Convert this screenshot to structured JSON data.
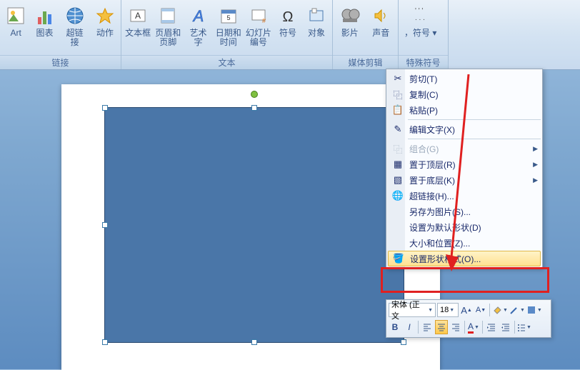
{
  "ribbon": {
    "groups": [
      {
        "label": "链接",
        "buttons": [
          {
            "name": "clipart-button",
            "label": "Art",
            "icon": "clipart"
          },
          {
            "name": "chart-button",
            "label": "图表",
            "icon": "chart"
          },
          {
            "name": "hyperlink-button",
            "label": "超链接",
            "icon": "globe"
          },
          {
            "name": "action-button",
            "label": "动作",
            "icon": "star"
          }
        ]
      },
      {
        "label": "文本",
        "buttons": [
          {
            "name": "textbox-button",
            "label": "文本框",
            "icon": "textbox"
          },
          {
            "name": "headerfooter-button",
            "label": "页眉和\n页脚",
            "icon": "headerfooter"
          },
          {
            "name": "wordart-button",
            "label": "艺术字",
            "icon": "wordart"
          },
          {
            "name": "datetime-button",
            "label": "日期和\n时间",
            "icon": "datetime"
          },
          {
            "name": "slidenumber-button",
            "label": "幻灯片\n编号",
            "icon": "slidenum"
          },
          {
            "name": "symbol-button",
            "label": "符号",
            "icon": "symbol"
          },
          {
            "name": "object-button",
            "label": "对象",
            "icon": "object"
          }
        ]
      },
      {
        "label": "媒体剪辑",
        "buttons": [
          {
            "name": "movie-button",
            "label": "影片",
            "icon": "movie"
          },
          {
            "name": "sound-button",
            "label": "声音",
            "icon": "sound"
          }
        ]
      },
      {
        "label": "特殊符号",
        "buttons": [
          {
            "name": "special-symbol-button",
            "label": "，符号 ▾",
            "icon": "comma"
          }
        ]
      }
    ]
  },
  "contextMenu": {
    "items": [
      {
        "name": "cut-item",
        "label": "剪切(T)",
        "icon": "✂",
        "type": "item"
      },
      {
        "name": "copy-item",
        "label": "复制(C)",
        "icon": "📄",
        "type": "item"
      },
      {
        "name": "paste-item",
        "label": "粘贴(P)",
        "icon": "📋",
        "type": "item"
      },
      {
        "type": "sep"
      },
      {
        "name": "edittext-item",
        "label": "编辑文字(X)",
        "icon": "✎",
        "type": "item"
      },
      {
        "type": "sep"
      },
      {
        "name": "group-item",
        "label": "组合(G)",
        "icon": "⿻",
        "type": "item",
        "disabled": true,
        "arrow": true
      },
      {
        "name": "bringfront-item",
        "label": "置于顶层(R)",
        "icon": "▦",
        "type": "item",
        "arrow": true
      },
      {
        "name": "sendback-item",
        "label": "置于底层(K)",
        "icon": "▧",
        "type": "item",
        "arrow": true
      },
      {
        "name": "hyperlink-item",
        "label": "超链接(H)...",
        "icon": "🌐",
        "type": "item"
      },
      {
        "name": "saveaspic-item",
        "label": "另存为图片(S)...",
        "icon": "",
        "type": "item"
      },
      {
        "name": "setdefault-item",
        "label": "设置为默认形状(D)",
        "icon": "",
        "type": "item"
      },
      {
        "name": "sizepos-item",
        "label": "大小和位置(Z)...",
        "icon": "",
        "type": "item"
      },
      {
        "name": "formatshape-item",
        "label": "设置形状格式(O)...",
        "icon": "🪣",
        "type": "item",
        "highlighted": true
      }
    ]
  },
  "miniToolbar": {
    "font": "宋体 (正文",
    "size": "18",
    "bold": "B",
    "italic": "I"
  }
}
